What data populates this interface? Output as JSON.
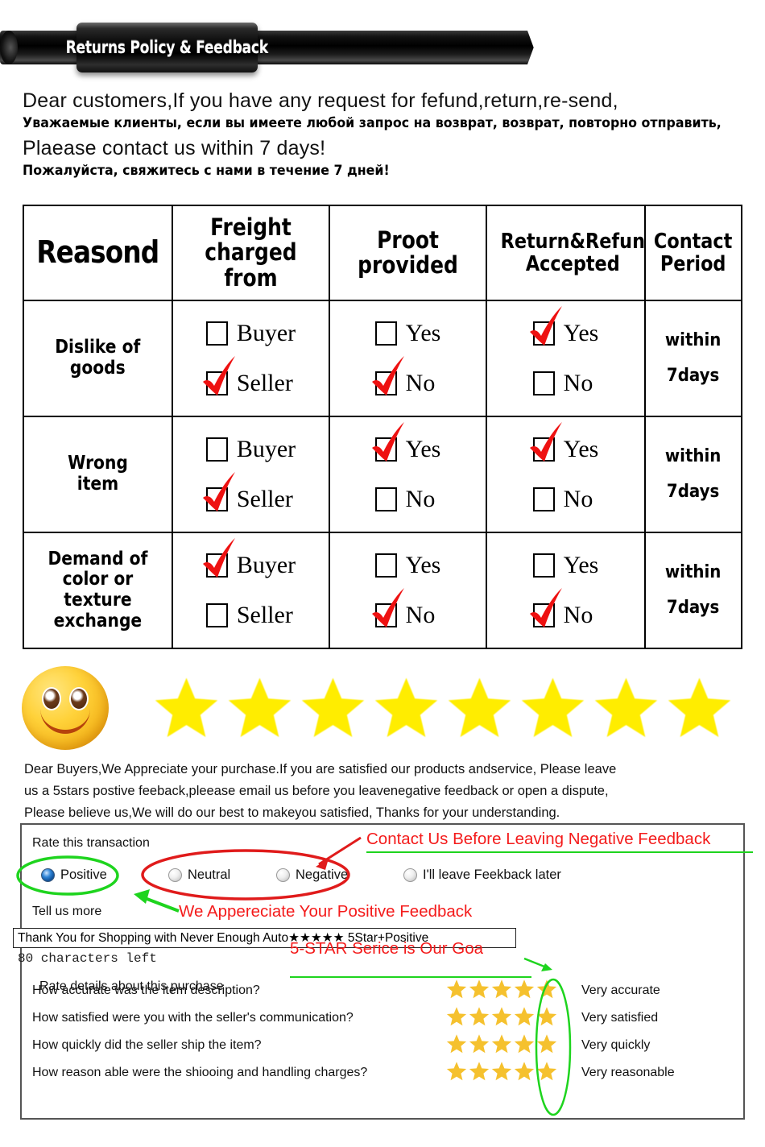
{
  "banner": {
    "title": "Returns Policy & Feedback"
  },
  "intro": {
    "line1_en": "Dear customers,If you have any request for fefund,return,re-send,",
    "line1_ru": "Уважаемые клиенты, если вы имеете любой запрос на возврат, возврат, повторно отправить,",
    "line2_en": "Plaease contact us within 7 days!",
    "line2_ru": "Пожалуйста, свяжитесь с нами в течение 7 дней!"
  },
  "table": {
    "headers": [
      "Reasond",
      "Freight charged from",
      "Proot provided",
      "Return&Refun Accepted",
      "Contact Period"
    ],
    "header_lines": [
      [
        "Reasond"
      ],
      [
        "Freight",
        "charged",
        "from"
      ],
      [
        "Proot",
        "provided"
      ],
      [
        "Return&Refun",
        "Accepted"
      ],
      [
        "Contact",
        "Period"
      ]
    ],
    "rows": [
      {
        "reason_lines": [
          "Dislike of",
          "goods"
        ],
        "freight": [
          {
            "label": "Buyer",
            "checked": false
          },
          {
            "label": "Seller",
            "checked": true
          }
        ],
        "proof": [
          {
            "label": "Yes",
            "checked": false
          },
          {
            "label": "No",
            "checked": true
          }
        ],
        "refund": [
          {
            "label": "Yes",
            "checked": true
          },
          {
            "label": "No",
            "checked": false
          }
        ],
        "period_lines": [
          "within",
          "7days"
        ]
      },
      {
        "reason_lines": [
          "Wrong",
          "item"
        ],
        "freight": [
          {
            "label": "Buyer",
            "checked": false
          },
          {
            "label": "Seller",
            "checked": true
          }
        ],
        "proof": [
          {
            "label": "Yes",
            "checked": true
          },
          {
            "label": "No",
            "checked": false
          }
        ],
        "refund": [
          {
            "label": "Yes",
            "checked": true
          },
          {
            "label": "No",
            "checked": false
          }
        ],
        "period_lines": [
          "within",
          "7days"
        ]
      },
      {
        "reason_lines": [
          "Demand of",
          "color or",
          "texture",
          "exchange"
        ],
        "freight": [
          {
            "label": "Buyer",
            "checked": true
          },
          {
            "label": "Seller",
            "checked": false
          }
        ],
        "proof": [
          {
            "label": "Yes",
            "checked": false
          },
          {
            "label": "No",
            "checked": true
          }
        ],
        "refund": [
          {
            "label": "Yes",
            "checked": false
          },
          {
            "label": "No",
            "checked": true
          }
        ],
        "period_lines": [
          "within",
          "7days"
        ]
      }
    ]
  },
  "rating_banner": {
    "star_count": 8,
    "star_color": "#FFED00",
    "smiley": "smiley-face"
  },
  "appreciate": {
    "line1": "Dear Buyers,We Appreciate your purchase.If you are satisfied our products andservice, Please leave",
    "line2": "us a 5stars postive feeback,pleease email us before you leavenegative feedback or open a dispute,",
    "line3": "Please believe us,We will do our best to makeyou satisfied, Thanks for your understanding."
  },
  "form": {
    "rate_transaction_label": "Rate this transaction",
    "tell_us_more_label": "Tell us more",
    "rate_details_label": "Rate details about this purchase",
    "radios": [
      {
        "label": "Positive",
        "selected": true
      },
      {
        "label": "Neutral",
        "selected": false
      },
      {
        "label": "Negative",
        "selected": false
      },
      {
        "label": "I'll leave Feekback later",
        "selected": false
      }
    ],
    "comment_value": "Thank You for Shopping with Never Enough Auto★★★★★ 5Star+Positive",
    "characters_left": "80 characters left",
    "detail_ratings": [
      {
        "question": "How accurate was the item description?",
        "stars": 5,
        "value": "Very accurate"
      },
      {
        "question": "How satisfied were you with the seller's communication?",
        "stars": 5,
        "value": "Very satisfied"
      },
      {
        "question": "How quickly did the seller ship the item?",
        "stars": 5,
        "value": "Very quickly"
      },
      {
        "question": "How reason able were the shiooing and handling charges?",
        "stars": 5,
        "value": "Very reasonable"
      }
    ],
    "star_color": "#F5C12E"
  },
  "annotations": {
    "negative_note": "Contact Us Before Leaving Negative Feedback",
    "positive_note": "We Appereciate Your Positive Feedback",
    "goal_note": "5-STAR Serice is Our Goa",
    "red": "#F41B1B",
    "green": "#1ED41E"
  }
}
